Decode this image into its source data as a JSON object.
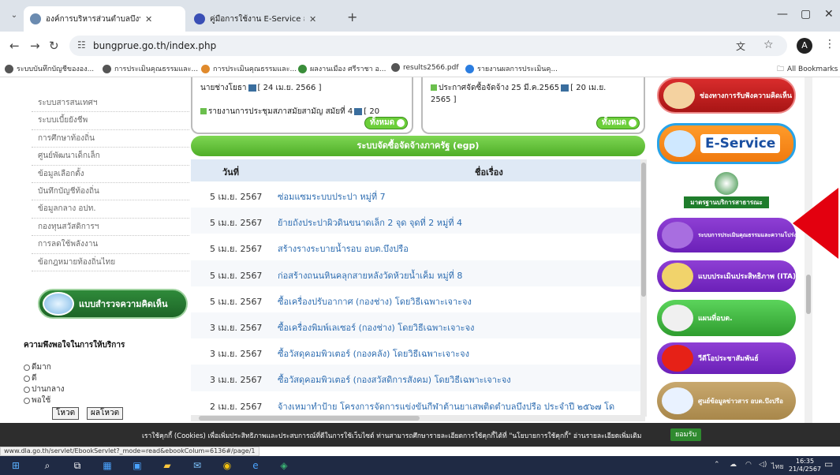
{
  "browser": {
    "tabs": [
      {
        "title": "องค์การบริหารส่วนตำบลบึงปรือ อำเภ",
        "favicon_color": "#6b8bb0",
        "active": true
      },
      {
        "title": "คู่มือการใช้งาน E-Service สำหรับประ",
        "favicon_color": "#3a4fb5",
        "active": false
      }
    ],
    "new_tab": "+",
    "url": "bungprue.go.th/index.php",
    "bookmarks": [
      {
        "label": "ระบบบันทึกบัญชีขององ...",
        "color": "#555"
      },
      {
        "label": "การประเมินคุณธรรมและ...",
        "color": "#555"
      },
      {
        "label": "การประเมินคุณธรรมและ...",
        "color": "#e08a2c"
      },
      {
        "label": "ผลงานเมือง ศรีราชา อ...",
        "color": "#3a8d3a"
      },
      {
        "label": "results2566.pdf",
        "color": "#555"
      },
      {
        "label": "รายงานผลการประเมินคุ...",
        "color": "#2b7de0"
      }
    ],
    "all_bookmarks": "All Bookmarks",
    "profile_initial": "A"
  },
  "sidebar": {
    "items": [
      "ระบบสารสนเทศฯ",
      "ระบบเบี้ยยังชีพ",
      "การศึกษาท้องถิ่น",
      "ศูนย์พัฒนาเด็กเล็ก",
      "ข้อมูลเลือกตั้ง",
      "บันทึกบัญชีท้องถิ่น",
      "ข้อมูลกลาง อปท.",
      "กองทุนสวัสดิการฯ",
      "การลดใช้พลังงาน",
      "ข้อกฎหมายท้องถิ่นไทย"
    ],
    "survey_banner": "แบบสำรวจความคิดเห็น",
    "survey_question": "ความพึงพอใจในการให้บริการ",
    "survey_options": [
      "ดีมาก",
      "ดี",
      "ปานกลาง",
      "พอใช้"
    ],
    "vote_button": "โหวต",
    "result_button": "ผลโหวต"
  },
  "news_left": {
    "line1": "นายช่างโยธา",
    "line1_date": "[ 24 เม.ย. 2566 ]",
    "line2": "รายงานการประชุมสภาสมัยสามัญ สมัยที่ 4",
    "line2_date": "[ 20",
    "all_button": "ทั้งหมด"
  },
  "news_right": {
    "line1": "ประกาศจัดซื้อจัดจ้าง 25 มี.ค.2565",
    "line1_date": "[ 20 เม.ย.",
    "line2": "2565 ]",
    "all_button": "ทั้งหมด"
  },
  "egp": {
    "header": "ระบบจัดซื้อจัดจ้างภาครัฐ (egp)",
    "col_date": "วันที่",
    "col_title": "ชื่อเรื่อง",
    "rows": [
      {
        "date": "5 เม.ย. 2567",
        "title": "ซ่อมแซมระบบประปา หมู่ที่ 7"
      },
      {
        "date": "5 เม.ย. 2567",
        "title": "ย้ายถังประปาผิวดินขนาดเล็ก 2 จุด จุดที่ 2 หมู่ที่ 4"
      },
      {
        "date": "5 เม.ย. 2567",
        "title": "สร้างรางระบายน้ำรอบ อบต.บึงปรือ"
      },
      {
        "date": "5 เม.ย. 2567",
        "title": "ก่อสร้างถนนหินคลุกสายหลังวัดห้วยน้ำเค็ม หมู่ที่ 8"
      },
      {
        "date": "5 เม.ย. 2567",
        "title": "ซื้อเครื่องปรับอากาศ (กองช่าง) โดยวิธีเฉพาะเจาะจง"
      },
      {
        "date": "3 เม.ย. 2567",
        "title": "ซื้อเครื่องพิมพ์เลเซอร์ (กองช่าง) โดยวิธีเฉพาะเจาะจง"
      },
      {
        "date": "3 เม.ย. 2567",
        "title": "ซื้อวัสดุคอมพิวเตอร์ (กองคลัง) โดยวิธีเฉพาะเจาะจง"
      },
      {
        "date": "3 เม.ย. 2567",
        "title": "ซื้อวัสดุคอมพิวเตอร์ (กองสวัสดิการสังคม) โดยวิธีเฉพาะเจาะจง"
      },
      {
        "date": "2 เม.ย. 2567",
        "title": "จ้างเหมาทำป้าย โครงการจัดการแข่งขันกีฬาต้านยาเสพติดตำบลบึงปรือ ประจำปี ๒๕๖๗ โด"
      }
    ]
  },
  "right_banners": {
    "complaint": "ช่องทางการรับฟังความคิดเห็น",
    "eservice": "E-Service",
    "standard": "มาตรฐานบริการสาธารณะ",
    "ita1": "ระบบการประเมินคุณธรรมและความโปร่งใส (ITA)",
    "ita2": "แบบประเมินประสิทธิภาพ (ITA)",
    "map": "แผนที่อบต.",
    "video": "วีดีโอประชาสัมพันธ์",
    "info": "ศูนย์ข้อมูลข่าวสาร อบต.บึงปรือ"
  },
  "cookie_bar": {
    "text": "เราใช้คุกกี้ (Cookies) เพื่อเพิ่มประสิทธิภาพและประสบการณ์ที่ดีในการใช้เว็บไซต์ ท่านสามารถศึกษารายละเอียดการใช้คุกกี้ได้ที่ \"นโยบายการใช้คุกกี้\" อ่านรายละเอียดเพิ่มเติม",
    "accept_button": "ยอมรับ"
  },
  "status_url": "www.dla.go.th/servlet/EbookServlet?_mode=read&ebookColum=6136#/page/1",
  "taskbar": {
    "time": "16:35",
    "date": "21/4/2567",
    "lang": "ไทย"
  },
  "colors": {
    "accent_green": "#4fae28",
    "link_blue": "#2e6db1",
    "highlight_red": "#e3000f"
  }
}
